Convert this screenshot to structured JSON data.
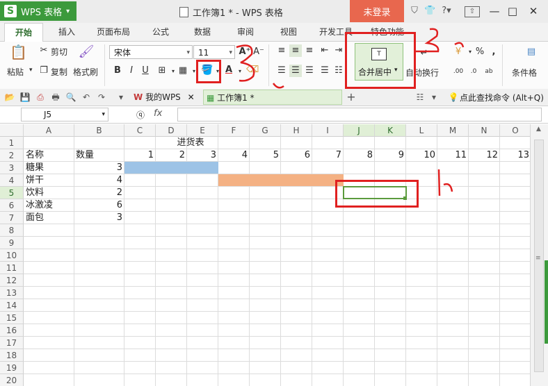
{
  "titlebar": {
    "app_logo": "S",
    "app_name": "WPS 表格",
    "doc_title": "工作簿1 * - WPS 表格",
    "login": "未登录"
  },
  "tabs": [
    "开始",
    "插入",
    "页面布局",
    "公式",
    "数据",
    "审阅",
    "视图",
    "开发工具",
    "特色功能"
  ],
  "ribbon": {
    "paste": "粘贴",
    "cut": "剪切",
    "copy": "复制",
    "format_painter": "格式刷",
    "font_name": "宋体",
    "font_size": "11",
    "merge_center": "合并居中",
    "auto_wrap": "自动换行",
    "conditional": "条件格",
    "bold": "B",
    "italic": "I",
    "underline": "U",
    "percent": "%",
    "comma": ","
  },
  "quickbar": {
    "doc_tabs": [
      "我的WPS",
      "工作簿1 *"
    ],
    "search_cmd": "点此查找命令 (Alt+Q)"
  },
  "formula_bar": {
    "cell_ref": "J5",
    "fx": "fx"
  },
  "columns": [
    "A",
    "B",
    "C",
    "D",
    "E",
    "F",
    "G",
    "H",
    "I",
    "J",
    "K",
    "L",
    "M",
    "N",
    "O"
  ],
  "rows": [
    "1",
    "2",
    "3",
    "4",
    "5",
    "6",
    "7",
    "8",
    "9",
    "10",
    "11",
    "12",
    "13",
    "14",
    "15",
    "16",
    "17",
    "18",
    "19",
    "20"
  ],
  "sheet": {
    "title": "进货表",
    "header_name": "名称",
    "header_qty": "数量",
    "day_numbers": [
      "1",
      "2",
      "3",
      "4",
      "5",
      "6",
      "7",
      "8",
      "9",
      "10",
      "11",
      "12",
      "13"
    ],
    "items": [
      {
        "name": "糖果",
        "qty": "3"
      },
      {
        "name": "饼干",
        "qty": "4"
      },
      {
        "name": "饮料",
        "qty": "2"
      },
      {
        "name": "冰激凌",
        "qty": "6"
      },
      {
        "name": "面包",
        "qty": "3"
      }
    ]
  },
  "colors": {
    "blue_fill": "#9dc3e6",
    "orange_fill": "#f4b183",
    "annotation": "#e02020",
    "selection": "#5b9b3d"
  }
}
